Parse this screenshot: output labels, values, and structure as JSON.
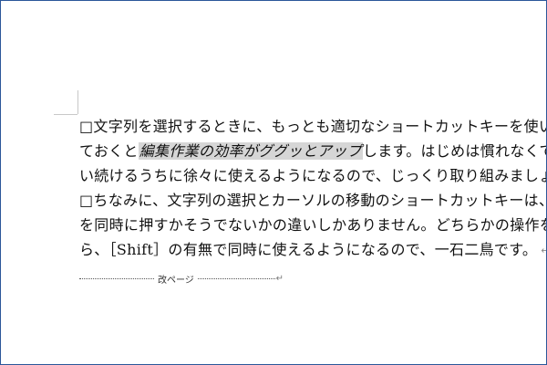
{
  "document": {
    "lines": [
      "□文字列を選択するときに、もっとも適切なショートカットキーを使い、",
      {
        "before": "ておくと",
        "selected": "編集作業の効率がググッとアップ",
        "after": "します。はじめは慣れなくても"
      },
      "い続けるうちに徐々に使えるようになるので、じっくり取り組みましょう",
      "□ちなみに、文字列の選択とカーソルの移動のショートカットキーは、は",
      "を同時に押すかそうでないかの違いしかありません。どちらかの操作を覚",
      "ら、［Shift］の有無で同時に使えるようになるので、一石二鳥です。"
    ],
    "paragraph_mark": "↵",
    "page_break_label": "改ページ"
  },
  "colors": {
    "selection": "#d6d6d6",
    "frame_border": "#2b579a"
  }
}
